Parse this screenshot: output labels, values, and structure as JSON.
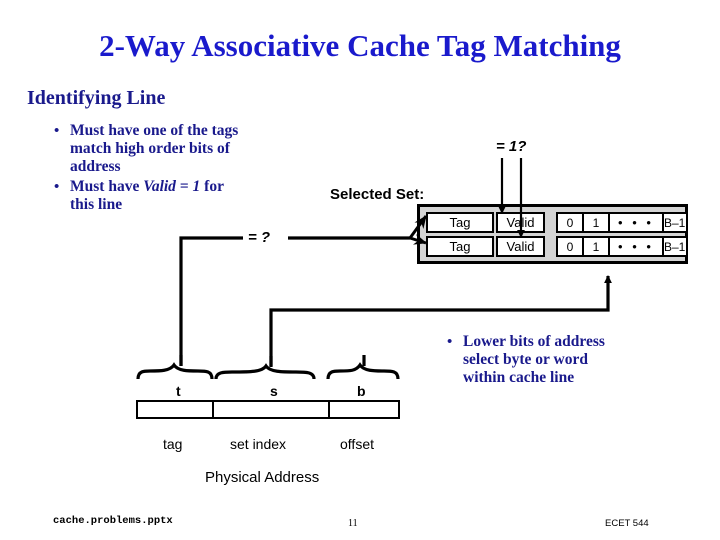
{
  "slide": {
    "title": "2-Way Associative Cache Tag Matching",
    "heading": "Identifying Line"
  },
  "bullets_left": [
    {
      "bullet": "•",
      "line1": "Must have one of the tags",
      "line2": "match high order bits of",
      "line3": "address"
    },
    {
      "bullet": "•",
      "pre": "Must have ",
      "emph": "Valid = 1",
      "post": " for",
      "line2": "this line"
    }
  ],
  "bullets_right": [
    {
      "bullet": "•",
      "line1": "Lower bits of address",
      "line2": "select byte or word",
      "line3": "within cache line"
    }
  ],
  "labels": {
    "selected_set": "Selected Set:",
    "eq_one": "= 1?",
    "eq_question": "= ?",
    "field_t": "t",
    "field_s": "s",
    "field_b": "b",
    "name_tag": "tag",
    "name_set_index": "set index",
    "name_offset": "offset",
    "physical_address": "Physical Address"
  },
  "cache_set": {
    "rows": [
      {
        "tag": "Tag",
        "valid": "Valid",
        "data": [
          "0",
          "1",
          "• • •",
          "B–1"
        ]
      },
      {
        "tag": "Tag",
        "valid": "Valid",
        "data": [
          "0",
          "1",
          "• • •",
          "B–1"
        ]
      }
    ]
  },
  "footer": {
    "file": "cache.problems.pptx",
    "page": "11",
    "course": "ECET 544"
  },
  "colors": {
    "title_blue": "#1A1ACC",
    "body_navy": "#1A1A8C",
    "panel_gray": "#D4D4D4",
    "line_black": "#000000"
  }
}
